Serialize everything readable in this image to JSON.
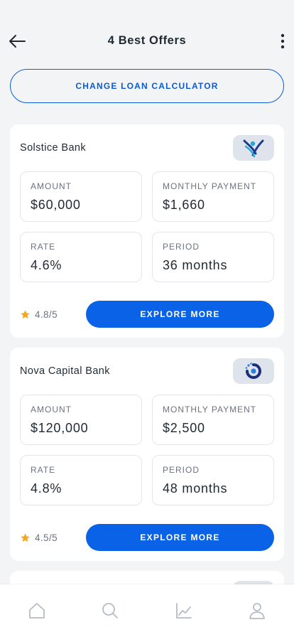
{
  "header": {
    "title": "4 Best Offers"
  },
  "calculator_button": {
    "label": "CHANGE LOAN CALCULATOR"
  },
  "offers": [
    {
      "bank": "Solstice Bank",
      "logo_icon": "solstice-bank-logo",
      "amount_label": "AMOUNT",
      "amount": "$60,000",
      "monthly_label": "MONTHLY PAYMENT",
      "monthly": "$1,660",
      "rate_label": "RATE",
      "rate": "4.6%",
      "period_label": "PERIOD",
      "period": "36 months",
      "rating": "4.8/5",
      "cta": "EXPLORE MORE"
    },
    {
      "bank": "Nova Capital Bank",
      "logo_icon": "nova-capital-logo",
      "amount_label": "AMOUNT",
      "amount": "$120,000",
      "monthly_label": "MONTHLY PAYMENT",
      "monthly": "$2,500",
      "rate_label": "RATE",
      "rate": "4.8%",
      "period_label": "PERIOD",
      "period": "48 months",
      "rating": "4.5/5",
      "cta": "EXPLORE MORE"
    }
  ],
  "bottom_nav": [
    "home-icon",
    "search-icon",
    "chart-icon",
    "profile-icon"
  ],
  "colors": {
    "accent": "#0a63e6",
    "star": "#f5a623",
    "background": "#f3f4f6"
  }
}
